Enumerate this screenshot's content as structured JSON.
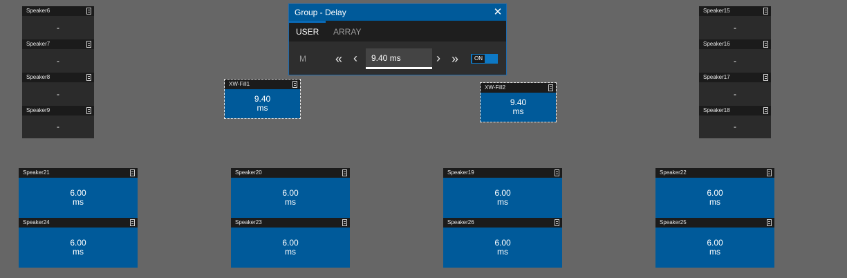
{
  "left_column": [
    {
      "name": "Speaker6",
      "value": "-"
    },
    {
      "name": "Speaker7",
      "value": "-"
    },
    {
      "name": "Speaker8",
      "value": "-"
    },
    {
      "name": "Speaker9",
      "value": "-"
    }
  ],
  "right_column": [
    {
      "name": "Speaker15",
      "value": "-"
    },
    {
      "name": "Speaker16",
      "value": "-"
    },
    {
      "name": "Speaker17",
      "value": "-"
    },
    {
      "name": "Speaker18",
      "value": "-"
    }
  ],
  "fills": [
    {
      "name": "XW-Fill1",
      "value": "9.40",
      "unit": "ms"
    },
    {
      "name": "XW-Fill2",
      "value": "9.40",
      "unit": "ms"
    }
  ],
  "bottom_row_1": [
    {
      "name": "Speaker21",
      "value": "6.00",
      "unit": "ms"
    },
    {
      "name": "Speaker20",
      "value": "6.00",
      "unit": "ms"
    },
    {
      "name": "Speaker19",
      "value": "6.00",
      "unit": "ms"
    },
    {
      "name": "Speaker22",
      "value": "6.00",
      "unit": "ms"
    }
  ],
  "bottom_row_2": [
    {
      "name": "Speaker24",
      "value": "6.00",
      "unit": "ms"
    },
    {
      "name": "Speaker23",
      "value": "6.00",
      "unit": "ms"
    },
    {
      "name": "Speaker26",
      "value": "6.00",
      "unit": "ms"
    },
    {
      "name": "Speaker25",
      "value": "6.00",
      "unit": "ms"
    }
  ],
  "dialog": {
    "title": "Group - Delay",
    "tabs": [
      "USER",
      "ARRAY"
    ],
    "active_tab": "USER",
    "mode_label": "M",
    "value": "9.40 ms",
    "toggle_label": "ON",
    "toggle_state": true
  },
  "colors": {
    "background": "#666666",
    "tile_blue": "#005a9a",
    "tile_dark": "#2b2b2b",
    "accent": "#0d78c4"
  },
  "icons": {
    "tile_header": "tile-menu-icon",
    "close": "close-icon",
    "fast_decrement": "double-chevron-left-icon",
    "decrement": "chevron-left-icon",
    "increment": "chevron-right-icon",
    "fast_increment": "double-chevron-right-icon"
  }
}
